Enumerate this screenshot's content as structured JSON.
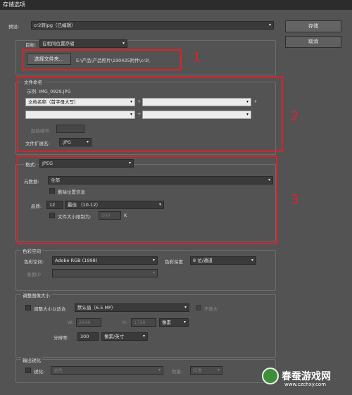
{
  "window": {
    "title": "存储选项"
  },
  "preset": {
    "label": "预设:",
    "value": "cr2转jpg（已编辑）"
  },
  "buttons": {
    "save": "存储",
    "cancel": "取消"
  },
  "destination": {
    "label": "目标:",
    "value": "在相同位置存储",
    "choose_folder": "选择文件夹...",
    "path": "E:\\产品\\产品照片\\190425附件\\cr2\\"
  },
  "file_naming": {
    "legend": "文件命名",
    "example": "示例: IMG_0929.JPG",
    "field1": "文档名称（首字母大写）",
    "field2": "",
    "field3": "",
    "field4": "",
    "plus": "+",
    "start_number_label": "起始编号",
    "extension_label": "文件扩展名:",
    "extension_value": ".JPG"
  },
  "format": {
    "label": "格式:",
    "value": "JPEG",
    "metadata_label": "元数据:",
    "metadata_value": "全部",
    "remove_location": "删除位置信息",
    "quality_label": "品质:",
    "quality_number": "12",
    "quality_value": "最佳 （10-12）",
    "limit_size": "文件大小限制为:",
    "limit_value": "500",
    "limit_unit": "K"
  },
  "color_space": {
    "legend": "色彩空间",
    "space_label": "色彩空间:",
    "space_value": "Adobe RGB (1998)",
    "depth_label": "色彩深度",
    "depth_value": "8 位/通道",
    "intent_label": "意图(I)",
    "intent_value": ""
  },
  "image_size": {
    "legend": "调整图像大小",
    "fit_label": "调整大小以适合",
    "fit_value": "默认值（6.5 MP）",
    "no_enlarge": "不放大",
    "w_label": "W:",
    "w_value": "2640",
    "h_label": "H:",
    "h_value": "1728",
    "units": "像素",
    "resolution_label": "分辨率:",
    "resolution_value": "300",
    "resolution_units": "像素/英寸"
  },
  "sharpen": {
    "legend": "输出锐化",
    "label": "锐化:",
    "value": "滤色",
    "amount_label": "数量:",
    "amount_value": "标准"
  },
  "annotations": {
    "n1": "1",
    "n2": "2",
    "n3": "3",
    "accent": "#e0202a"
  },
  "watermark": {
    "brand": "春蚕游戏网",
    "url": "www.czchxy.com"
  }
}
